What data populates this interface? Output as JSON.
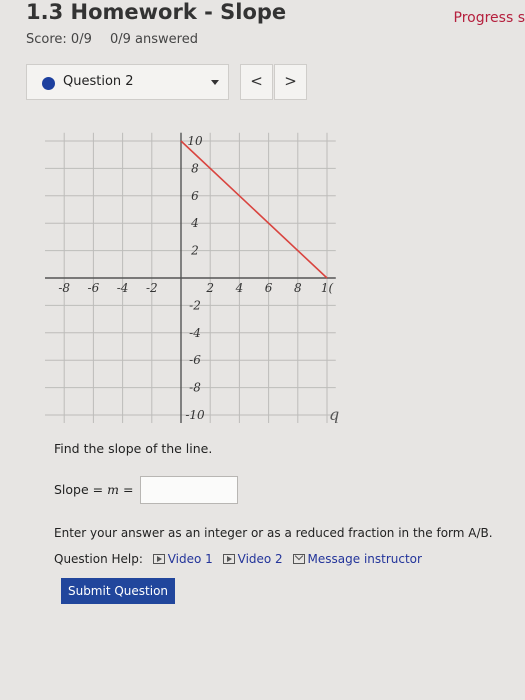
{
  "header": {
    "title": "1.3 Homework - Slope",
    "progress_label": "Progress s",
    "score": "Score: 0/9",
    "answered": "0/9 answered"
  },
  "question_nav": {
    "selected": "Question 2",
    "prev_label": "<",
    "next_label": ">"
  },
  "graph": {
    "x_ticks": [
      "10",
      "-8",
      "-6",
      "-4",
      "-2",
      "2",
      "4",
      "6",
      "8",
      "1("
    ],
    "y_ticks": [
      "10",
      "8",
      "6",
      "4",
      "2",
      "-2",
      "-4",
      "-6",
      "-8",
      "-10"
    ],
    "handwritten_mark": "q",
    "line_color": "#d9443f",
    "line_points": [
      {
        "x": 0,
        "y": 10
      },
      {
        "x": 10,
        "y": 0
      }
    ]
  },
  "question": {
    "prompt": "Find the slope of the line.",
    "slope_label": "Slope = ",
    "slope_var": "m",
    "slope_eq": " =",
    "answer_value": "",
    "instructions": "Enter your answer as an integer or as a reduced fraction in the form A/B.",
    "help_label": "Question Help:",
    "video1": "Video 1",
    "video2": "Video 2",
    "message": "Message instructor",
    "submit_label": "Submit Question"
  }
}
